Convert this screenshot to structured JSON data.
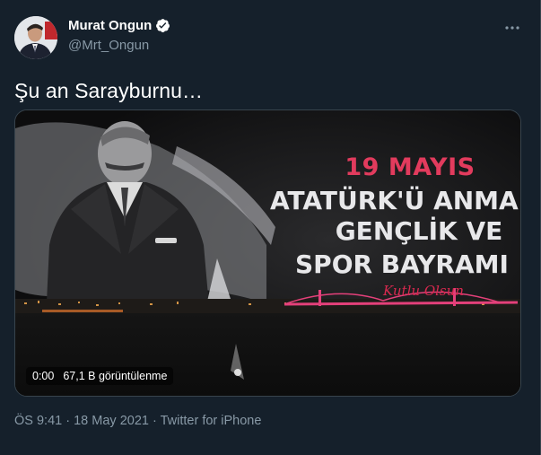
{
  "author": {
    "display_name": "Murat Ongun",
    "handle": "@Mrt_Ongun",
    "verified": true
  },
  "tweet": {
    "text": "Şu an Sarayburnu…"
  },
  "media": {
    "type": "video",
    "time": "0:00",
    "views": "67,1 B görüntülenme",
    "overlay_lines": [
      "19 MAYIS",
      "ATATÜRK'Ü ANMA",
      "GENÇLİK VE",
      "SPOR BAYRAMI",
      "Kutlu Olsun"
    ]
  },
  "meta": {
    "time": "ÖS 9:41",
    "separator": "·",
    "date": "18 May 2021",
    "source": "Twitter for iPhone"
  },
  "colors": {
    "background": "#15202b",
    "secondary_text": "#8899a6",
    "verified": "#ffffff",
    "overlay_red": "#e23b5d"
  },
  "icons": {
    "verified": "verified-badge-icon",
    "more": "more-options-icon"
  }
}
